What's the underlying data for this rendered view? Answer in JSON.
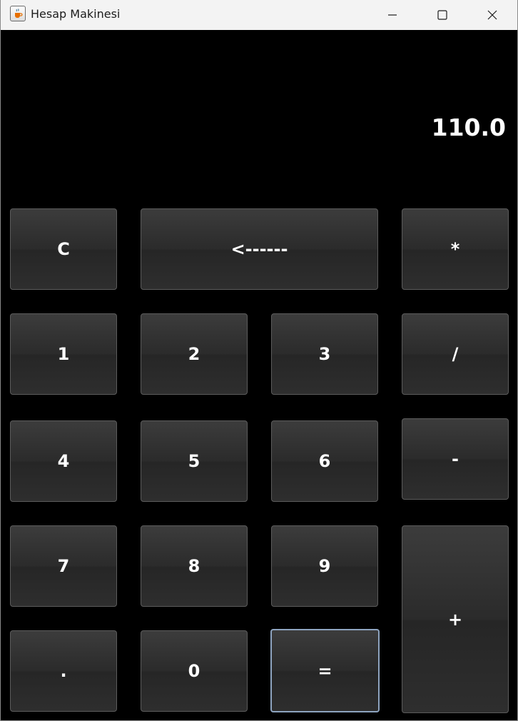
{
  "window": {
    "title": "Hesap Makinesi",
    "icon": "java-cup-icon",
    "controls": [
      "minimize-icon",
      "maximize-icon",
      "close-icon"
    ]
  },
  "display": {
    "value": "110.0"
  },
  "keys": {
    "clear": "C",
    "backspace": "<------",
    "multiply": "*",
    "one": "1",
    "two": "2",
    "three": "3",
    "divide": "/",
    "four": "4",
    "five": "5",
    "six": "6",
    "subtract": "-",
    "seven": "7",
    "eight": "8",
    "nine": "9",
    "add": "+",
    "decimal": ".",
    "zero": "0",
    "equals": "="
  },
  "colors": {
    "background": "#000000",
    "key_face": "#2e2e2e",
    "key_border": "#5c5c5c",
    "focus_border": "#8ea4c0",
    "text": "#ffffff"
  }
}
